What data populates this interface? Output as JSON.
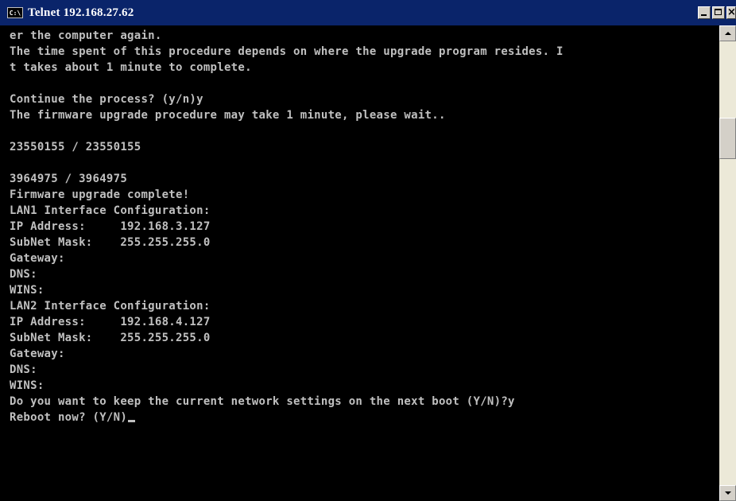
{
  "window": {
    "title": "Telnet 192.168.27.62",
    "icon_name": "console-icon",
    "icon_text": "C:\\",
    "controls": {
      "minimize": "minimize",
      "maximize": "maximize",
      "close": "×"
    }
  },
  "colors": {
    "titlebar": "#0a246a",
    "terminal_bg": "#000000",
    "terminal_fg": "#c0c0c0"
  },
  "terminal": {
    "lines": [
      "er the computer again.",
      "The time spent of this procedure depends on where the upgrade program resides. I",
      "t takes about 1 minute to complete.",
      "",
      "Continue the process? (y/n)y",
      "The firmware upgrade procedure may take 1 minute, please wait..",
      "",
      "23550155 / 23550155",
      "",
      "3964975 / 3964975",
      "Firmware upgrade complete!",
      "LAN1 Interface Configuration:",
      "IP Address:     192.168.3.127",
      "SubNet Mask:    255.255.255.0",
      "Gateway:",
      "DNS:",
      "WINS:",
      "LAN2 Interface Configuration:",
      "IP Address:     192.168.4.127",
      "SubNet Mask:    255.255.255.0",
      "Gateway:",
      "DNS:",
      "WINS:",
      "Do you want to keep the current network settings on the next boot (Y/N)?y",
      "Reboot now? (Y/N)"
    ]
  }
}
